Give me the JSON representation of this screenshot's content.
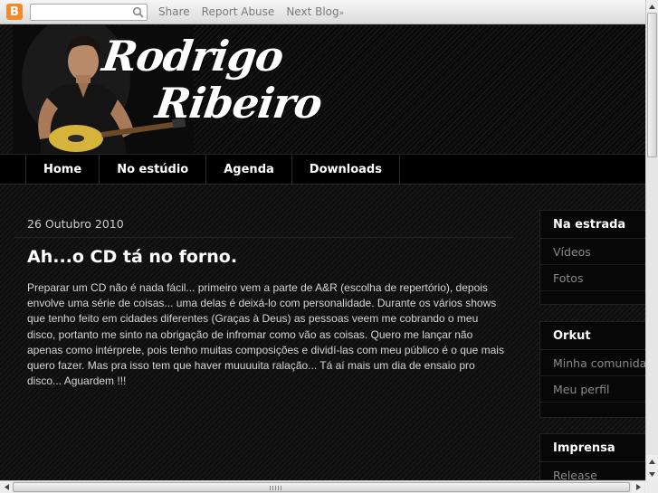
{
  "navbar": {
    "logo_letter": "B",
    "search_value": "",
    "search_icon": "search-icon",
    "share_label": "Share",
    "report_label": "Report Abuse",
    "next_blog_label": "Next Blog",
    "next_blog_chevron": "»"
  },
  "header": {
    "title_line1": "Rodrigo",
    "title_line2": "Ribeiro"
  },
  "tabs": [
    "Home",
    "No estúdio",
    "Agenda",
    "Downloads"
  ],
  "post": {
    "date": "26 Outubro 2010",
    "title": "Ah...o CD tá no forno.",
    "body": "Preparar um CD não é nada fácil... primeiro vem a parte de A&R (escolha de repertório), depois envolve uma série de coisas... uma delas é deixá-lo com personalidade. Durante os vários shows que tenho feito em cidades diferentes (Graças à Deus) as pessoas veem me cobrando o meu disco, portanto me sinto na obrigação de infromar como vão as coisas. Quero me lançar não apenas como intérprete, pois tenho muitas composições e dividí-las com meu público é o que mais quero fazer. Mas pra isso tem que haver muuuuita ralação... Tá aí mais um dia de ensaio pro disco... Aguardem !!!"
  },
  "sidebar": {
    "widgets": [
      {
        "title": "Na estrada",
        "items": [
          "Vídeos",
          "Fotos"
        ]
      },
      {
        "title": "Orkut",
        "items": [
          "Minha comunidade",
          "Meu perfil"
        ]
      },
      {
        "title": "Imprensa",
        "items": [
          "Release"
        ]
      }
    ]
  },
  "colors": {
    "background": "#111111",
    "text": "#d6d6d6",
    "title": "#ffffff",
    "sidebar_link": "#8a8a8a",
    "blogger_orange": "#f38b2c"
  }
}
